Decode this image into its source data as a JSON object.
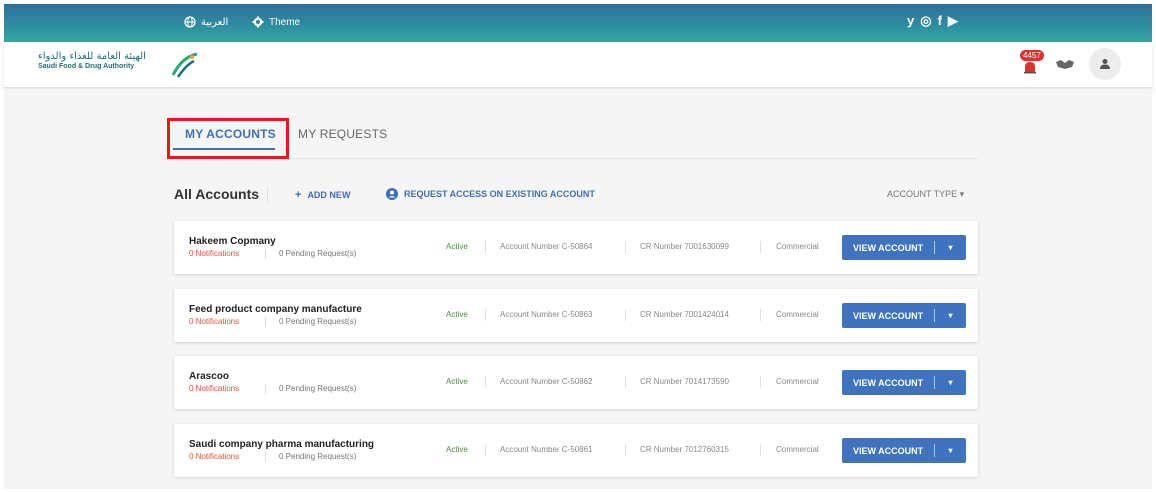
{
  "topbar": {
    "language_label": "العربية",
    "theme_label": "Theme",
    "social": [
      {
        "name": "twitter-icon",
        "glyph": "y"
      },
      {
        "name": "instagram-icon",
        "glyph": "◎"
      },
      {
        "name": "facebook-icon",
        "glyph": "f"
      },
      {
        "name": "youtube-icon",
        "glyph": "▶"
      }
    ]
  },
  "header": {
    "logo_ar": "الهيئة العامة للغذاء والدواء",
    "logo_en": "Saudi Food & Drug Authority",
    "notification_count": "4457"
  },
  "tabs": {
    "my_accounts": "MY ACCOUNTS",
    "my_requests": "MY REQUESTS"
  },
  "accounts_bar": {
    "title": "All Accounts",
    "add_new": "ADD NEW",
    "request_access": "REQUEST ACCESS ON EXISTING ACCOUNT",
    "account_type": "ACCOUNT TYPE ▾"
  },
  "accounts": [
    {
      "name": "Hakeem Copmany",
      "notifications": "0 Notifications",
      "pending": "0 Pending Request(s)",
      "status": "Active",
      "account_number": "Account Number C-50864",
      "cr_number": "CR Number 7001630099",
      "type": "Commercial",
      "button": "VIEW ACCOUNT"
    },
    {
      "name": "Feed product company manufacture",
      "notifications": "0 Notifications",
      "pending": "0 Pending Request(s)",
      "status": "Active",
      "account_number": "Account Number C-50863",
      "cr_number": "CR Number 7001424014",
      "type": "Commercial",
      "button": "VIEW ACCOUNT"
    },
    {
      "name": "Arascoo",
      "notifications": "0 Notifications",
      "pending": "0 Pending Request(s)",
      "status": "Active",
      "account_number": "Account Number C-50862",
      "cr_number": "CR Number 7014173590",
      "type": "Commercial",
      "button": "VIEW ACCOUNT"
    },
    {
      "name": "Saudi company pharma manufacturing",
      "notifications": "0 Notifications",
      "pending": "0 Pending Request(s)",
      "status": "Active",
      "account_number": "Account Number C-50861",
      "cr_number": "CR Number 7012760315",
      "type": "Commercial",
      "button": "VIEW ACCOUNT"
    }
  ],
  "colors": {
    "accent": "#3f73bf",
    "highlight_box": "#e41b1b",
    "status_active": "#4a8c3f",
    "notifications_text": "#e5533c"
  }
}
